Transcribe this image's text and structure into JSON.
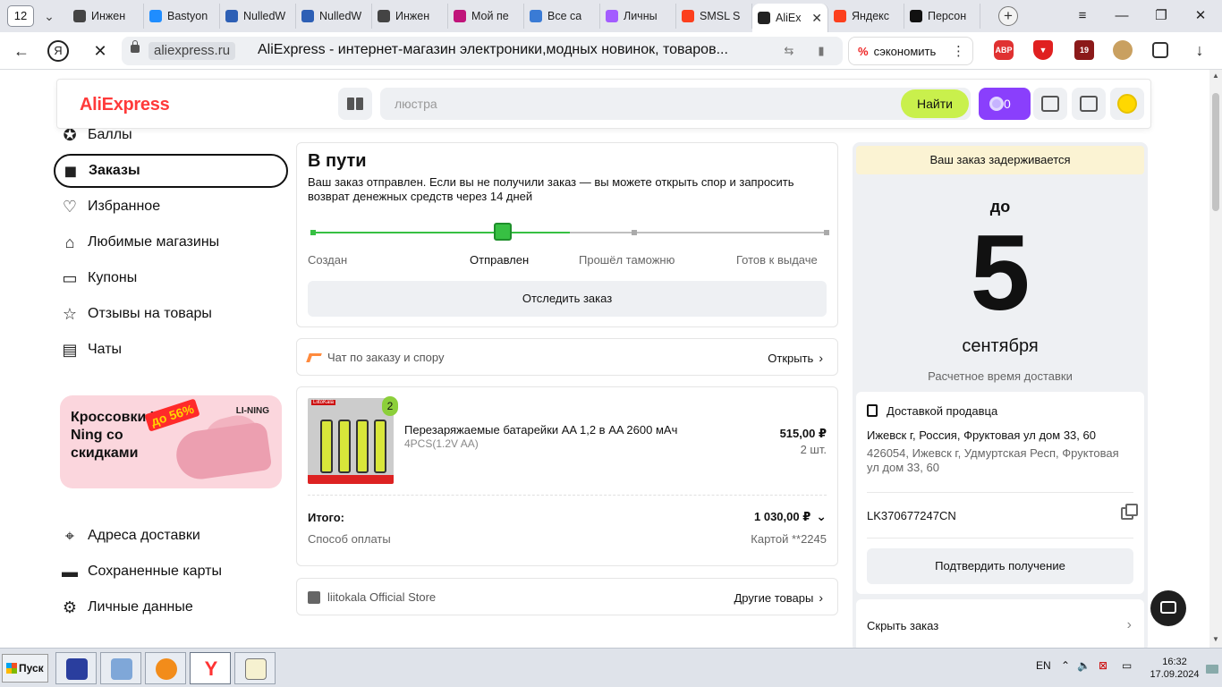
{
  "browser": {
    "tab_count": "12",
    "tabs": [
      {
        "label": "Инжен",
        "color": "#444"
      },
      {
        "label": "Bastyon",
        "color": "#1f8dff"
      },
      {
        "label": "NulledW",
        "color": "#2d5fb5"
      },
      {
        "label": "NulledW",
        "color": "#2d5fb5"
      },
      {
        "label": "Инжен",
        "color": "#444"
      },
      {
        "label": "Мой пе",
        "color": "#c0147a"
      },
      {
        "label": "Все са",
        "color": "#3a7bd5"
      },
      {
        "label": "Личны",
        "color": "#a35cff"
      },
      {
        "label": "SMSL S",
        "color": "#fc3f1d"
      },
      {
        "label": "AliEx",
        "color": "#222"
      },
      {
        "label": "Яндекс",
        "color": "#fc3f1d"
      },
      {
        "label": "Персон",
        "color": "#111"
      }
    ],
    "domain": "aliexpress.ru",
    "page_title": "AliExpress - интернет-магазин электроники,модных новинок, товаров...",
    "save_label": "сэкономить",
    "ext_abp": "ABP",
    "ext_badge": "19"
  },
  "header": {
    "logo": "AliExpress",
    "search_placeholder": "люстра",
    "search_button": "Найти",
    "coins": "0"
  },
  "sidebar": {
    "items": [
      {
        "label": "Баллы",
        "icon": "points-icon"
      },
      {
        "label": "Заказы",
        "icon": "box-icon"
      },
      {
        "label": "Избранное",
        "icon": "heart-icon"
      },
      {
        "label": "Любимые магазины",
        "icon": "store-icon"
      },
      {
        "label": "Купоны",
        "icon": "coupon-icon"
      },
      {
        "label": "Отзывы на товары",
        "icon": "star-icon"
      },
      {
        "label": "Чаты",
        "icon": "chat-icon"
      }
    ],
    "promo": {
      "text": "Кроссовки Li-Ning со скидками",
      "discount": "до 56%",
      "brand": "LI-NING"
    },
    "bottom_items": [
      {
        "label": "Адреса доставки",
        "icon": "location-icon"
      },
      {
        "label": "Сохраненные карты",
        "icon": "card-icon"
      },
      {
        "label": "Личные данные",
        "icon": "settings-icon"
      }
    ]
  },
  "order_status": {
    "title": "В пути",
    "text": "Ваш заказ отправлен. Если вы не получили заказ — вы можете открыть спор и запросить возврат денежных средств через 14 дней",
    "steps": [
      "Создан",
      "Отправлен",
      "Прошёл таможню",
      "Готов к выдаче"
    ],
    "current_step": 2,
    "progress_fraction": 0.5,
    "track_button": "Отследить заказ"
  },
  "chat": {
    "label": "Чат по заказу и спору",
    "open": "Открыть"
  },
  "product": {
    "image_label": "LiitoKala",
    "qty_badge": "2",
    "name": "Перезаряжаемые батарейки AA 1,2 в AA 2600 мАч",
    "variant": "4PCS(1.2V AA)",
    "price": "515,00 ₽",
    "qty": "2 шт.",
    "total_label": "Итого:",
    "total": "1 030,00 ₽",
    "payment_label": "Способ оплаты",
    "payment": "Картой **2245"
  },
  "store": {
    "name": "liitokala Official Store",
    "other": "Другие товары"
  },
  "delivery": {
    "delayed": "Ваш заказ задерживается",
    "upto": "до",
    "day": "5",
    "month": "сентября",
    "eta_label": "Расчетное время доставки",
    "method": "Доставкой продавца",
    "address_main": "Ижевск г, Россия, Фруктовая ул дом 33, 60",
    "address_sub": "426054, Ижевск г, Удмуртская Респ, Фруктовая ул дом 33, 60",
    "tracking": "LK370677247CN",
    "confirm": "Подтвердить получение",
    "hide": "Скрыть заказ"
  },
  "taskbar": {
    "start": "Пуск",
    "lang": "EN",
    "time": "16:32",
    "date": "17.09.2024"
  }
}
